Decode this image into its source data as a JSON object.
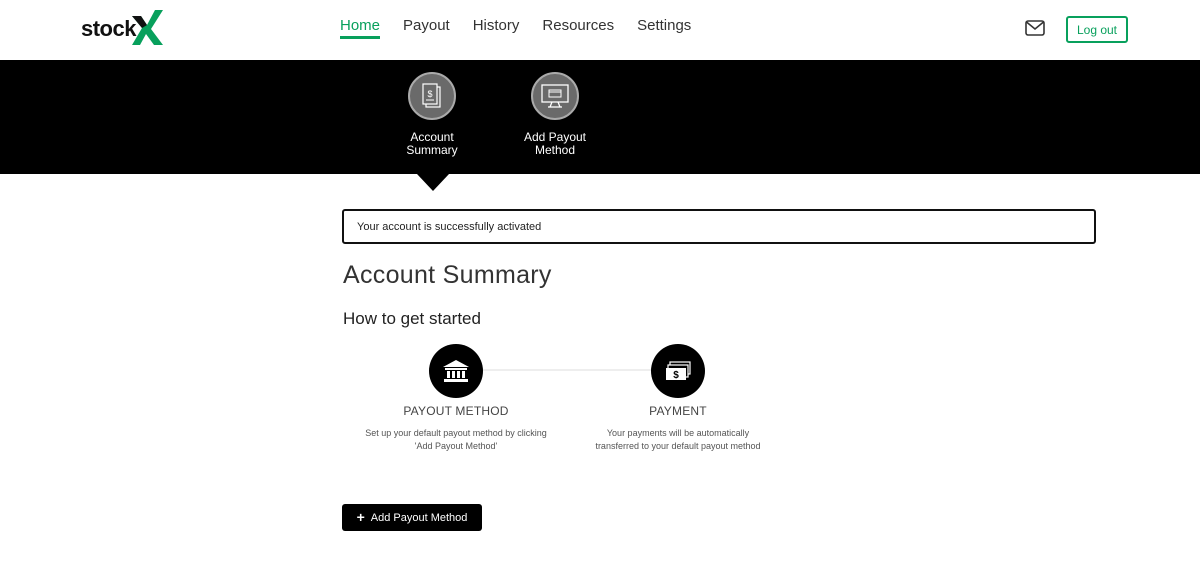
{
  "brand": {
    "logo_text": "stock",
    "logo_x": "X",
    "accent_color": "#08a05c"
  },
  "nav": {
    "items": [
      {
        "label": "Home",
        "active": true
      },
      {
        "label": "Payout",
        "active": false
      },
      {
        "label": "History",
        "active": false
      },
      {
        "label": "Resources",
        "active": false
      },
      {
        "label": "Settings",
        "active": false
      }
    ],
    "mail_icon": "mail-icon",
    "logout_label": "Log out"
  },
  "steps": [
    {
      "line1": "Account",
      "line2": "Summary",
      "icon": "document-dollar-icon"
    },
    {
      "line1": "Add Payout",
      "line2": "Method",
      "icon": "monitor-card-icon"
    }
  ],
  "alert": {
    "text": "Your account is successfully activated"
  },
  "main": {
    "title": "Account Summary",
    "subtitle": "How to get started",
    "features": [
      {
        "icon": "bank-icon",
        "title": "PAYOUT METHOD",
        "desc_line1": "Set up your default payout method by clicking",
        "desc_line2": "'Add Payout Method'"
      },
      {
        "icon": "money-icon",
        "title": "PAYMENT",
        "desc_line1": "Your payments will be automatically",
        "desc_line2": "transferred to your default payout method"
      }
    ],
    "add_button_label": "Add Payout Method"
  }
}
